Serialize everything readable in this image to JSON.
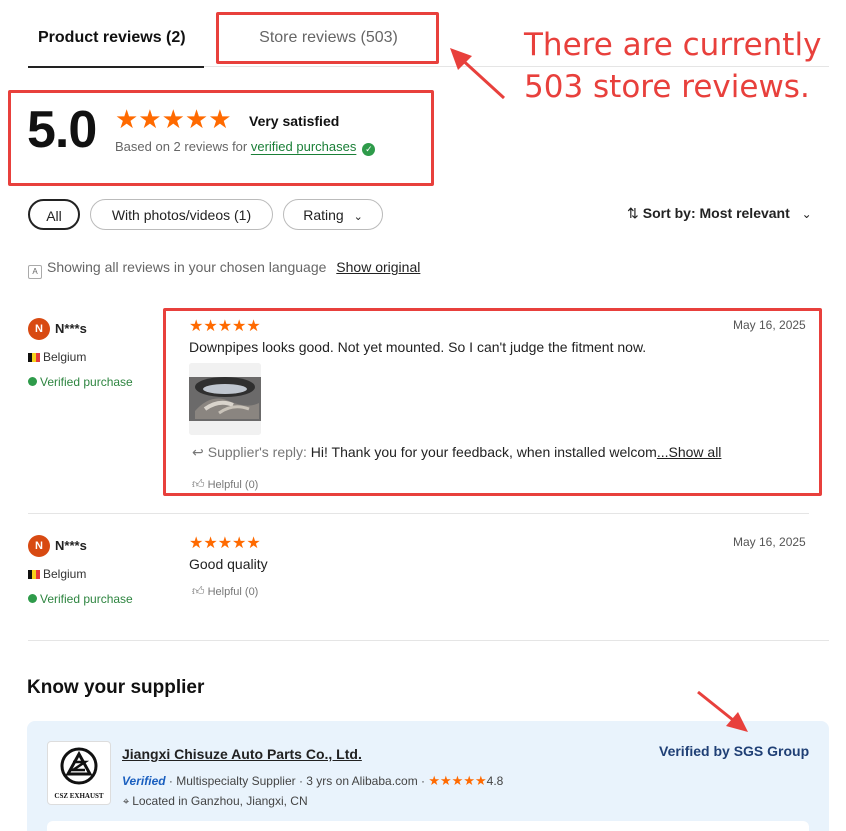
{
  "tabs": {
    "product_reviews": "Product reviews (2)",
    "store_reviews": "Store reviews (503)"
  },
  "annotations": {
    "callout_line1": "There are currently",
    "callout_line2": "503 store reviews."
  },
  "summary": {
    "score": "5.0",
    "stars": "★★★★★",
    "label": "Very satisfied",
    "based_on": "Based on 2 reviews for",
    "verified_link": "verified purchases"
  },
  "filters": {
    "all": "All",
    "photos": "With photos/videos (1)",
    "rating": "Rating",
    "sort_prefix": "Sort by:",
    "sort_value": "Most relevant"
  },
  "language": {
    "notice": "Showing all reviews in your chosen language",
    "show_original": "Show original"
  },
  "reviews": [
    {
      "avatar": "N",
      "name": "N***s",
      "country": "Belgium",
      "verified": "Verified purchase",
      "stars": "★★★★★",
      "date": "May 16, 2025",
      "text": "Downpipes looks good. Not yet mounted. So I can't judge the fitment now.",
      "reply_label": "Supplier's reply:",
      "reply_text": "Hi! Thank you for your feedback, when installed welcom",
      "reply_more": "...Show all",
      "helpful": "Helpful (0)"
    },
    {
      "avatar": "N",
      "name": "N***s",
      "country": "Belgium",
      "verified": "Verified purchase",
      "stars": "★★★★★",
      "date": "May 16, 2025",
      "text": "Good quality",
      "helpful": "Helpful (0)"
    }
  ],
  "supplier": {
    "heading": "Know your supplier",
    "name": "Jiangxi Chisuze Auto Parts Co., Ltd.",
    "verified_badge": "Verified",
    "meta": "· Multispecialty Supplier · 3 yrs on Alibaba.com ·",
    "stars": "★★★★★",
    "rating": "4.8",
    "location": "Located in Ganzhou, Jiangxi, CN",
    "sgs": "Verified by SGS Group",
    "logo_text": "CSZ EXHAUST"
  },
  "colors": {
    "accent_orange": "#ff6a00",
    "annotation_red": "#e8403c",
    "verified_green": "#1a7f37"
  }
}
